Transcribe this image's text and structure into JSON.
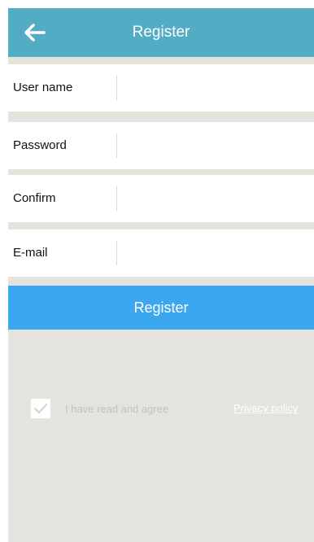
{
  "header": {
    "back_icon": "arrow-left-icon",
    "title": "Register"
  },
  "form": {
    "fields": [
      {
        "label": "User name",
        "value": "",
        "placeholder": ""
      },
      {
        "label": "Password",
        "value": "",
        "placeholder": ""
      },
      {
        "label": "Confirm",
        "value": "",
        "placeholder": ""
      },
      {
        "label": "E-mail",
        "value": "",
        "placeholder": ""
      }
    ],
    "submit_label": "Register"
  },
  "agreement": {
    "checked": true,
    "text": "I have read and agree",
    "link_text": "Privacy policy"
  },
  "colors": {
    "header_bg": "#52adc4",
    "button_bg": "#3aa7ee",
    "page_bg": "#e5e3de"
  }
}
